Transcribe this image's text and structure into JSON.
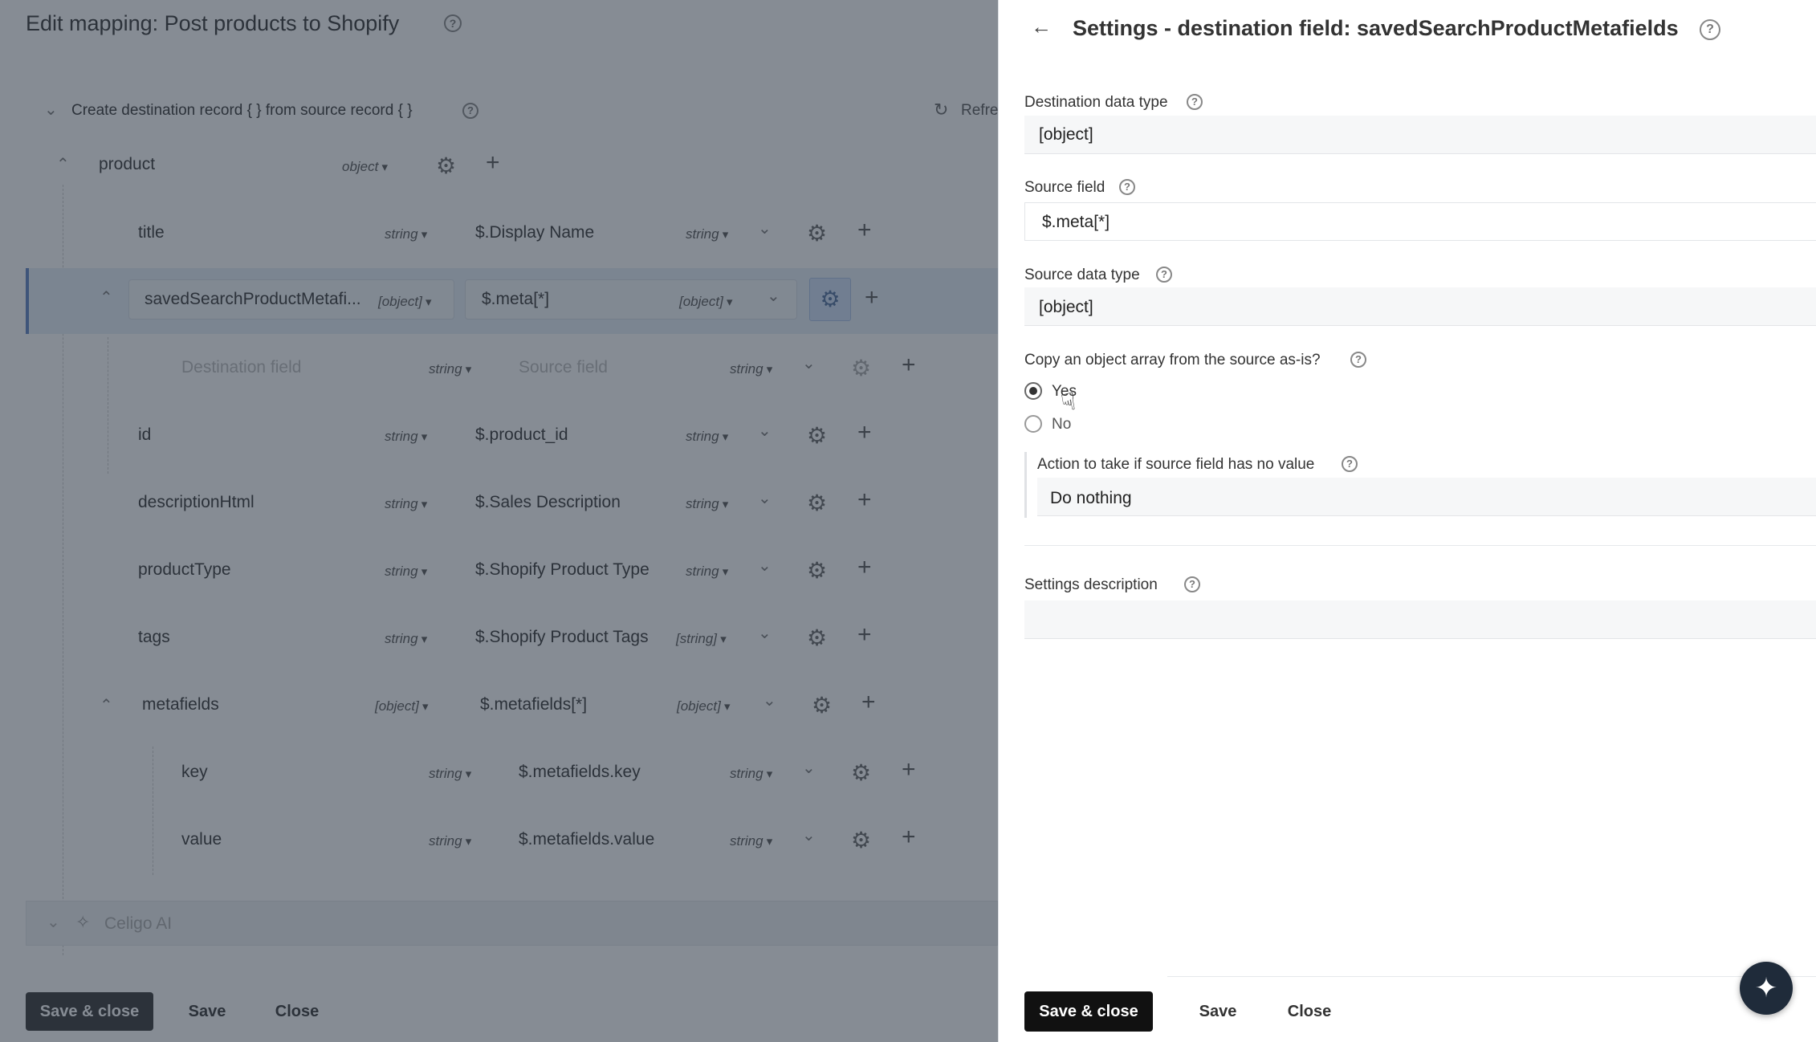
{
  "editor": {
    "title": "Edit mapping: Post products to Shopify",
    "record_header": "Create destination record { } from source record { }",
    "refresh_label": "Refre",
    "rows": [
      {
        "field": "product",
        "dtype": "object",
        "source": "",
        "stype": ""
      },
      {
        "field": "title",
        "dtype": "string",
        "source": "$.Display Name",
        "stype": "string"
      },
      {
        "field": "savedSearchProductMetafi...",
        "dtype": "[object]",
        "source": "$.meta[*]",
        "stype": "[object]"
      },
      {
        "field": "Destination field",
        "dtype": "string",
        "source": "Source field",
        "stype": "string"
      },
      {
        "field": "id",
        "dtype": "string",
        "source": "$.product_id",
        "stype": "string"
      },
      {
        "field": "descriptionHtml",
        "dtype": "string",
        "source": "$.Sales Description",
        "stype": "string"
      },
      {
        "field": "productType",
        "dtype": "string",
        "source": "$.Shopify Product Type",
        "stype": "string"
      },
      {
        "field": "tags",
        "dtype": "string",
        "source": "$.Shopify Product Tags",
        "stype": "[string]"
      },
      {
        "field": "metafields",
        "dtype": "[object]",
        "source": "$.metafields[*]",
        "stype": "[object]"
      },
      {
        "field": "key",
        "dtype": "string",
        "source": "$.metafields.key",
        "stype": "string"
      },
      {
        "field": "value",
        "dtype": "string",
        "source": "$.metafields.value",
        "stype": "string"
      }
    ],
    "celigo_ai": "Celigo AI",
    "buttons": {
      "save_close": "Save & close",
      "save": "Save",
      "close": "Close"
    }
  },
  "drawer": {
    "title": "Settings - destination field: savedSearchProductMetafields",
    "dest_type_label": "Destination data type",
    "dest_type_value": "[object]",
    "source_field_label": "Source field",
    "source_field_value": "$.meta[*]",
    "source_type_label": "Source data type",
    "source_type_value": "[object]",
    "copy_label": "Copy an object array from the source as-is?",
    "opt_yes": "Yes",
    "opt_no": "No",
    "action_label": "Action to take if source field has no value",
    "action_value": "Do nothing",
    "desc_label": "Settings description",
    "desc_value": "",
    "buttons": {
      "save_close": "Save & close",
      "save": "Save",
      "close": "Close"
    }
  },
  "icons": [
    "arrow-left-icon",
    "help-icon",
    "gear-icon",
    "plus-icon",
    "chevron-down-icon",
    "refresh-icon",
    "sparkle-icon",
    "pointer-cursor-icon"
  ]
}
